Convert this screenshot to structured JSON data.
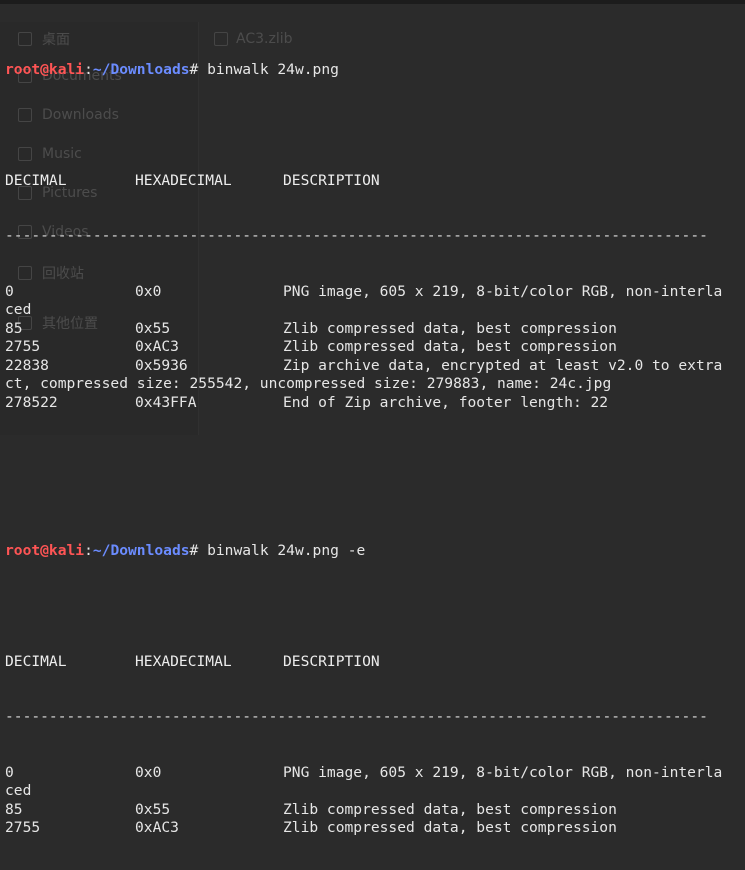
{
  "prompt": {
    "user": "root@kali",
    "colon": ":",
    "path": "~/Downloads",
    "symbol": "# "
  },
  "commands": [
    "binwalk 24w.png",
    "binwalk 24w.png -e"
  ],
  "table_header": [
    "DECIMAL",
    "HEXADECIMAL",
    "DESCRIPTION"
  ],
  "separator": "--------------------------------------------------------------------------------",
  "output1": [
    {
      "dec": "0",
      "hex": "0x0",
      "desc": "PNG image, 605 x 219, 8-bit/color RGB, non-interla"
    },
    {
      "dec": "ced",
      "hex": "",
      "desc": ""
    },
    {
      "dec": "85",
      "hex": "0x55",
      "desc": "Zlib compressed data, best compression"
    },
    {
      "dec": "2755",
      "hex": "0xAC3",
      "desc": "Zlib compressed data, best compression"
    },
    {
      "dec": "22838",
      "hex": "0x5936",
      "desc": "Zip archive data, encrypted at least v2.0 to extra"
    },
    {
      "dec": "ct, compressed size: 255542, uncompressed size: 279883, name: 24c.jpg",
      "hex": "",
      "desc": ""
    },
    {
      "dec": "278522",
      "hex": "0x43FFA",
      "desc": "End of Zip archive, footer length: 22"
    }
  ],
  "output2": [
    {
      "dec": "0",
      "hex": "0x0",
      "desc": "PNG image, 605 x 219, 8-bit/color RGB, non-interla"
    },
    {
      "dec": "ced",
      "hex": "",
      "desc": ""
    },
    {
      "dec": "85",
      "hex": "0x55",
      "desc": "Zlib compressed data, best compression"
    },
    {
      "dec": "2755",
      "hex": "0xAC3",
      "desc": "Zlib compressed data, best compression"
    }
  ],
  "background_fm": {
    "sidebar": [
      "桌面",
      "Documents",
      "Downloads",
      "Music",
      "Pictures",
      "Videos",
      "回收站",
      "其他位置"
    ],
    "file": "AC3.zlib"
  },
  "colors": {
    "user": "#ff5555",
    "path": "#6b8cff",
    "text": "#e6e6e6",
    "background": "#2b2b2b"
  }
}
